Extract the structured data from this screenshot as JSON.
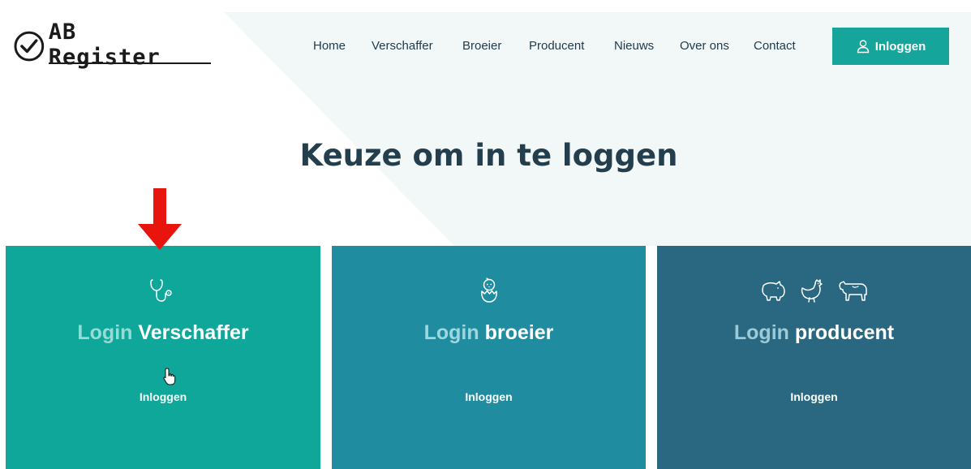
{
  "brand": {
    "name": "AB Register"
  },
  "nav": {
    "items": [
      {
        "label": "Home"
      },
      {
        "label": "Verschaffer"
      },
      {
        "label": "Broeier"
      },
      {
        "label": "Producent"
      },
      {
        "label": "Nieuws"
      },
      {
        "label": "Over ons"
      },
      {
        "label": "Contact"
      }
    ],
    "login_label": "Inloggen"
  },
  "main": {
    "heading": "Keuze om in te loggen",
    "cards": [
      {
        "prefix": "Login",
        "title": "Verschaffer",
        "action": "Inloggen",
        "icon": "stethoscope-icon"
      },
      {
        "prefix": "Login",
        "title": "broeier",
        "action": "Inloggen",
        "icon": "hatching-chick-icon"
      },
      {
        "prefix": "Login",
        "title": "producent",
        "action": "Inloggen",
        "icon": "farm-animals-icon"
      }
    ]
  },
  "colors": {
    "accent": "#16a59a",
    "card_verschaffer": "#0ea79a",
    "card_broeier": "#1f8c9f",
    "card_producent": "#2a6881",
    "heading": "#233f4e",
    "annotation_arrow": "#e8150f"
  }
}
